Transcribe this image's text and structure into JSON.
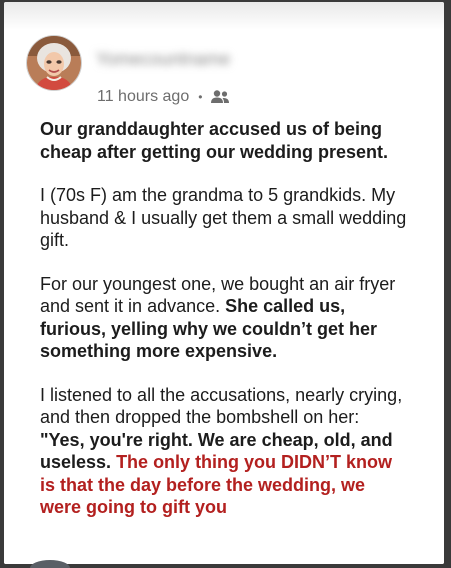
{
  "post": {
    "author": "Yomecountname",
    "time": "11 hours ago",
    "audience_icon": "group-icon",
    "title": "Our granddaughter accused us of being cheap after getting our wedding present.",
    "p1": "I (70s F) am the grandma to 5 grandkids. My husband & I usually get them a small wedding gift.",
    "p2_normal": "For our youngest one, we bought an air fryer and sent it in advance. ",
    "p2_bold": "She called us, furious, yelling why we couldn’t get her something more expensive.",
    "p3_normal": "I listened to all the accusations, nearly crying, and then dropped the bombshell on her:",
    "p3_bold": "\"Yes, you're right. We are cheap, old, and useless. ",
    "p3_red": "The only thing you DIDN’T know is that the day before the wedding, we were going to gift you"
  },
  "colors": {
    "accent_red": "#b3201f",
    "text": "#1c1c1c",
    "meta": "#6d6d6d"
  }
}
